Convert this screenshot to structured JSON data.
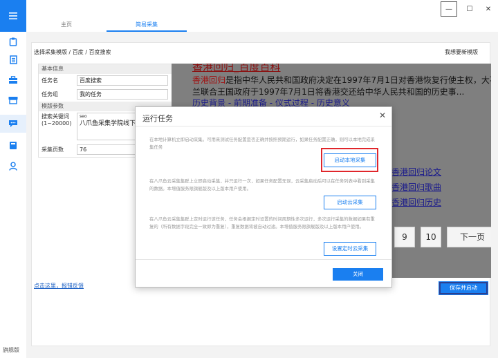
{
  "window": {
    "tabs": [
      {
        "label": "主页"
      },
      {
        "label": "简易采集"
      }
    ],
    "minimize_glyph": "—",
    "maximize_glyph": "☐",
    "close_glyph": "✕"
  },
  "sidebar": {
    "icons": [
      "menu-icon",
      "clipboard-icon",
      "document-icon",
      "briefcase-icon",
      "store-icon",
      "chat-icon",
      "book-icon",
      "user-icon"
    ],
    "flag_label": "旗舰版"
  },
  "page": {
    "breadcrumb": "选择采集模版 / 百度 / 百度搜索",
    "new_template_link": "我想要新模版",
    "feedback_link": "点击这里，报错反馈",
    "save_button": "保存并启动"
  },
  "params": {
    "basic_header": "基本信息",
    "task_name_label": "任务名",
    "task_name_value": "百度搜索",
    "task_group_label": "任务组",
    "task_group_value": "我的任务",
    "template_header": "模版参数",
    "keyword_label": "搜索关键词\n(1~20000)",
    "keyword_values": [
      "seo",
      "八爪鱼采集学院线下培训"
    ],
    "pages_label": "采集页数",
    "pages_value": "76"
  },
  "preview": {
    "title": "香港回归_百度百科",
    "desc_highlight": "香港回归",
    "desc_line1": "是指中华人民共和国政府决定在1997年7月1日对香港恢复行使主权，大不列颠及北爱尔",
    "desc_line2": "兰联合王国政府于1997年7月1日将香港交还给中华人民共和国的历史事...",
    "links": "历史背景 - 前期准备 - 仪式过程 - 历史意义",
    "related": [
      "香港回归论文",
      "香港回归歌曲",
      "香港回归历史"
    ],
    "pager": [
      "9",
      "10",
      "下一页"
    ]
  },
  "dialog": {
    "title": "运行任务",
    "close_glyph": "✕",
    "local_desc": "在本地计算机立即启动采集。可用来测试任务配置是否正确并按照预期运行，如果任务配置正确，则可以本地完成采集任务",
    "local_button": "启动本地采集",
    "cloud_desc": "在八爪鱼云采集集群上立即启动采集，并只运行一次，如果任务配置无误，云采集启动后可以在任务列表中看到采集的数据。本增值服务限旗舰版及以上版本用户使用。",
    "cloud_button": "启动云采集",
    "scheduled_desc": "在八爪鱼云采集集群上定时运行该任务，任务会根据定时设置的时间周期性多次运行，多次运行采集的数据如果有重复的（所有数据字段完全一致即为重复），重复数据将被自动过滤。本增值服务限旗舰版及以上版本用户使用。",
    "scheduled_button": "设置定时云采集",
    "close_button": "关闭"
  },
  "colors": {
    "accent": "#1a7ff0",
    "highlight_border": "#e0262b"
  }
}
